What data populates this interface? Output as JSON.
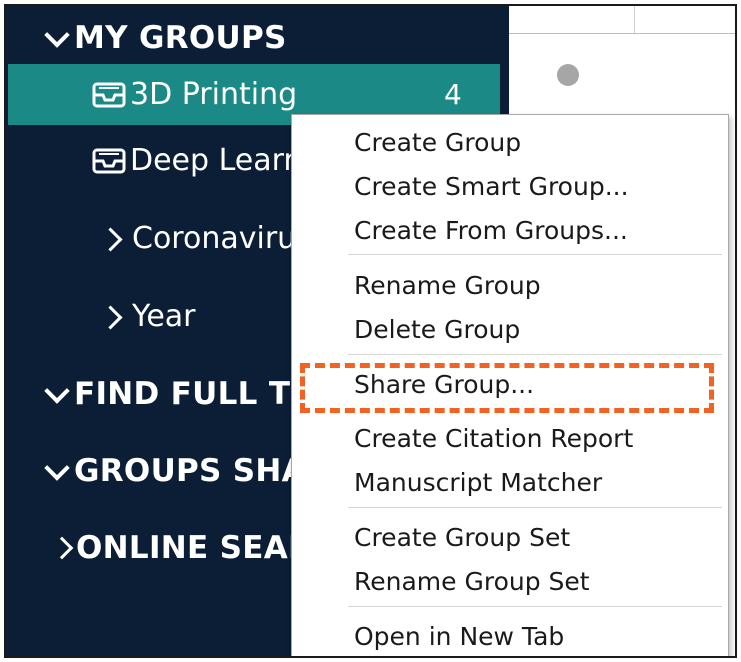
{
  "sidebar": {
    "sections": [
      {
        "label": "MY GROUPS",
        "expanded": true,
        "icon": "chevron-down-icon"
      },
      {
        "label": "FIND FULL TE",
        "expanded": true,
        "icon": "chevron-down-icon"
      },
      {
        "label": "GROUPS SHA",
        "expanded": true,
        "icon": "chevron-down-icon"
      },
      {
        "label": "ONLINE SEAR",
        "expanded": false,
        "icon": "chevron-right-icon"
      }
    ],
    "groups": [
      {
        "label": "3D Printing",
        "count": "4",
        "icon": "tray-icon",
        "selected": true
      },
      {
        "label": "Deep Learr",
        "icon": "tray-icon"
      },
      {
        "label": "Coronaviru",
        "icon": "chevron-right-icon"
      },
      {
        "label": "Year",
        "icon": "chevron-right-icon"
      }
    ]
  },
  "context_menu": {
    "items": [
      "Create Group",
      "Create Smart Group...",
      "Create From Groups...",
      "Rename Group",
      "Delete Group",
      "Share Group...",
      "Create Citation Report",
      "Manuscript Matcher",
      "Create Group Set",
      "Rename Group Set",
      "Open in New Tab"
    ],
    "highlighted": "Share Group...",
    "highlight_color": "#f26322"
  },
  "colors": {
    "sidebar_bg": "#0b1e36",
    "selected_bg": "#1b8a87"
  }
}
